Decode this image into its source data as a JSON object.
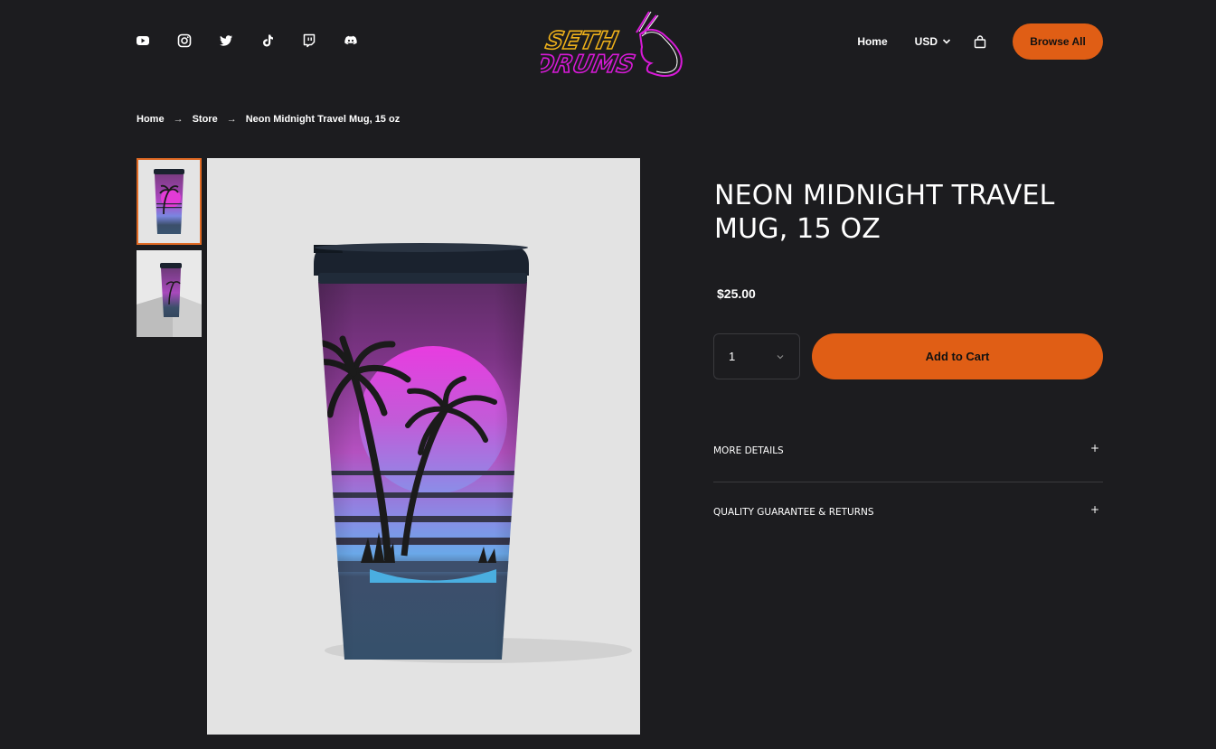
{
  "header": {
    "social_icons": [
      "youtube-icon",
      "instagram-icon",
      "twitter-icon",
      "tiktok-icon",
      "twitch-icon",
      "discord-icon"
    ],
    "logo_text": [
      "SETH",
      "DRUMS"
    ],
    "nav": {
      "home": "Home",
      "currency": "USD",
      "browse_all": "Browse All"
    }
  },
  "breadcrumb": {
    "home": "Home",
    "store": "Store",
    "current": "Neon Midnight Travel Mug, 15 oz",
    "separator": "→"
  },
  "product": {
    "title": "Neon Midnight Travel Mug, 15 oz",
    "price": "$25.00",
    "quantity": "1",
    "add_to_cart": "Add to Cart"
  },
  "accordion": {
    "more_details": "MORE DETAILS",
    "quality": "QUALITY GUARANTEE & RETURNS",
    "toggle": "+"
  },
  "colors": {
    "background": "#1c1c1f",
    "accent": "#e05e15",
    "logo_yellow": "#f0b21a",
    "logo_magenta": "#d81ad8"
  }
}
